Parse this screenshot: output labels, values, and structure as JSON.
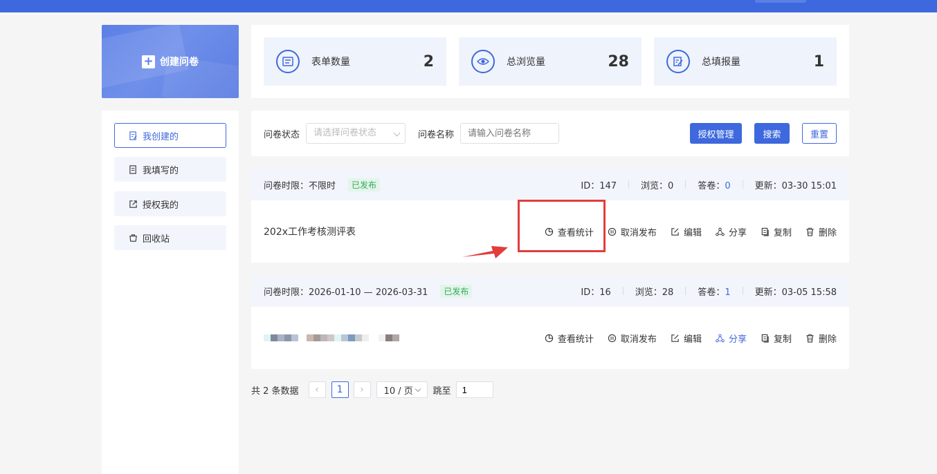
{
  "sidebar": {
    "create_label": "创建问卷",
    "items": [
      {
        "label": "我创建的"
      },
      {
        "label": "我填写的"
      },
      {
        "label": "授权我的"
      },
      {
        "label": "回收站"
      }
    ]
  },
  "stats": [
    {
      "label": "表单数量",
      "value": "2",
      "icon": "form-list-icon"
    },
    {
      "label": "总浏览量",
      "value": "28",
      "icon": "eye-icon"
    },
    {
      "label": "总填报量",
      "value": "1",
      "icon": "edit-doc-icon"
    }
  ],
  "filter": {
    "status_label": "问卷状态",
    "status_placeholder": "请选择问卷状态",
    "name_label": "问卷名称",
    "name_placeholder": "请输入问卷名称",
    "auth_btn": "授权管理",
    "search_btn": "搜索",
    "reset_btn": "重置"
  },
  "surveys": [
    {
      "period": "问卷时限：不限时",
      "status": "已发布",
      "id": "ID：147",
      "views": "浏览：0",
      "answers_label": "答卷：",
      "answers": "0",
      "updated": "更新：03-30 15:01",
      "title": "202x工作考核测评表"
    },
    {
      "period": "问卷时限：2026-01-10 — 2026-03-31",
      "status": "已发布",
      "id": "ID：16",
      "views": "浏览：28",
      "answers_label": "答卷：",
      "answers": "1",
      "updated": "更新：03-05 15:58",
      "title": ""
    }
  ],
  "actions": {
    "stats": "查看统计",
    "unpublish": "取消发布",
    "edit": "编辑",
    "share": "分享",
    "copy": "复制",
    "delete": "删除"
  },
  "pagination": {
    "total": "共 2 条数据",
    "current": "1",
    "page_size": "10 / 页",
    "jump_label": "跳至",
    "jump_value": "1"
  },
  "colors": {
    "accent": "#3e68dd",
    "published_badge": "#35a75d",
    "highlight": "#e23c3c"
  }
}
